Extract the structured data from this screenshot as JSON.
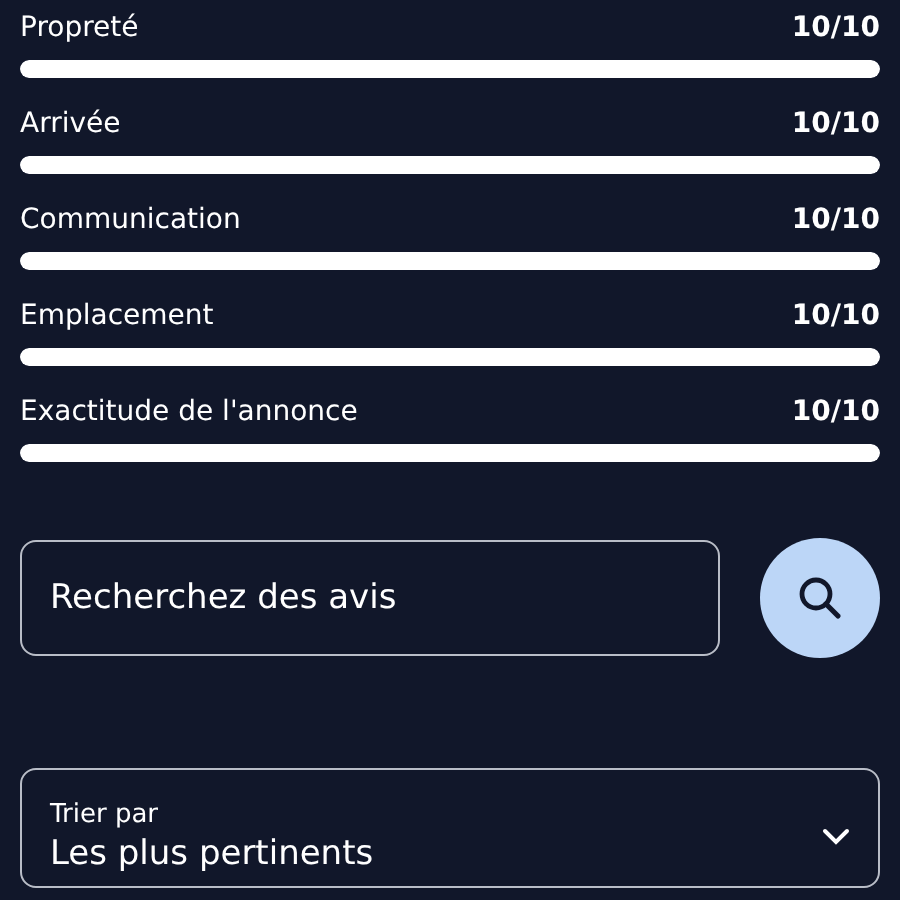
{
  "ratings": [
    {
      "label": "Propreté",
      "value": "10/10",
      "level": 1
    },
    {
      "label": "Arrivée",
      "value": "10/10",
      "level": 1
    },
    {
      "label": "Communication",
      "value": "10/10",
      "level": 1
    },
    {
      "label": "Emplacement",
      "value": "10/10",
      "level": 1
    },
    {
      "label": "Exactitude de l'annonce",
      "value": "10/10",
      "level": 1
    }
  ],
  "search": {
    "placeholder": "Recherchez des avis"
  },
  "sort": {
    "label": "Trier par",
    "value": "Les plus pertinents"
  }
}
